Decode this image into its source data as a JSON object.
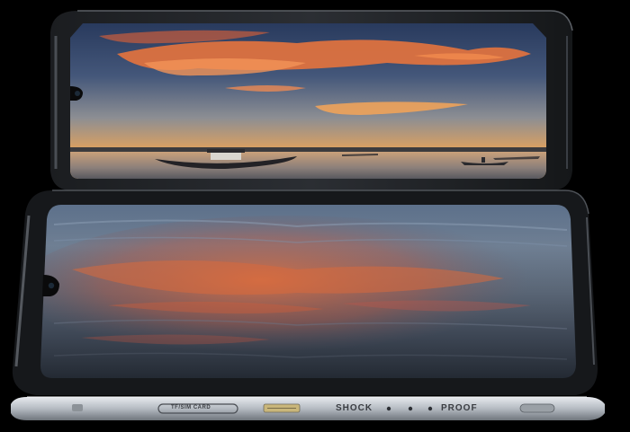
{
  "device": {
    "sim_slot_label": "TF/SIM CARD",
    "shock_label": "SHOCK",
    "proof_label": "PROOF"
  },
  "colors": {
    "background": "#000000",
    "frame_metal": "#bfc4c9",
    "sky_top": "#31466c",
    "cloud_glow": "#f07a3e",
    "water": "#4a5360"
  }
}
